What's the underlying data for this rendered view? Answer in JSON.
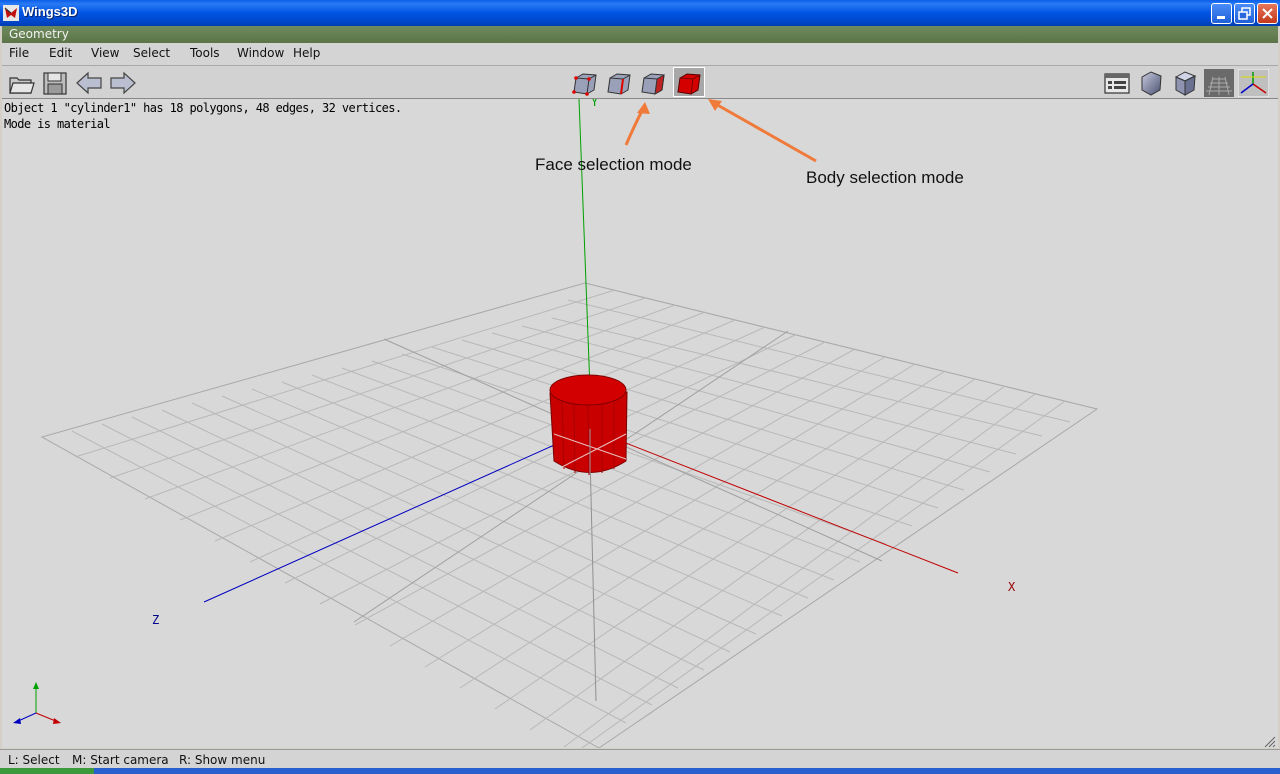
{
  "window": {
    "title": "Wings3D"
  },
  "geometry_bar": {
    "title": "Geometry"
  },
  "menu": [
    "File",
    "Edit",
    "View",
    "Select",
    "Tools",
    "Window",
    "Help"
  ],
  "toolbar": {
    "left_icons": [
      "open-folder-icon",
      "save-disk-icon",
      "undo-arrow-icon",
      "redo-arrow-icon"
    ],
    "selection_modes": [
      "vertex-mode-icon",
      "edge-mode-icon",
      "face-mode-icon",
      "body-mode-icon"
    ],
    "active_mode": "body",
    "right_icons": [
      "outliner-icon",
      "smooth-shading-icon",
      "flat-shading-icon",
      "groundplane-icon",
      "axes-icon"
    ]
  },
  "viewport": {
    "info_line1": "Object 1 \"cylinder1\" has 18 polygons, 48 edges, 32 vertices.",
    "info_line2": "Mode is material",
    "annotations": {
      "face": "Face selection mode",
      "body": "Body selection mode"
    },
    "axis_labels": {
      "y": "Y",
      "x": "X",
      "z": "Z"
    },
    "colors": {
      "x_axis": "#c00000",
      "y_axis": "#00a000",
      "z_axis": "#0000c0",
      "object": "#d40000",
      "annotation_arrow": "#f07a3a"
    }
  },
  "status": {
    "left": "L: Select",
    "middle": "M: Start camera",
    "right": "R: Show menu"
  }
}
